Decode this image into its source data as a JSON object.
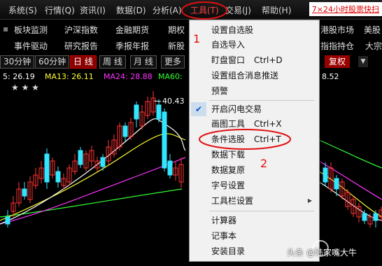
{
  "menubar": {
    "items": [
      {
        "label": "系统(S)",
        "active": false
      },
      {
        "label": "行情(Q)",
        "active": false
      },
      {
        "label": "资讯(I)",
        "active": false
      },
      {
        "label": "数据(D)",
        "active": false
      },
      {
        "label": "分析(A)",
        "active": false
      },
      {
        "label": "工具(T)",
        "active": true
      },
      {
        "label": "交易(J)",
        "active": false
      },
      {
        "label": "帮助(H)",
        "active": false
      }
    ],
    "promo": "7×24小时股票快扫"
  },
  "toolbar": {
    "row2": [
      "板块监测",
      "沪深指数",
      "金融期货",
      "期权",
      "港股市场",
      "美股"
    ],
    "row3": [
      "事件驱动",
      "研究报告",
      "季报年报",
      "新股",
      "指指持仓",
      "大宗"
    ]
  },
  "periods": {
    "tabs": [
      "30分钟",
      "60分钟",
      "日 线",
      "周 线",
      "月 线",
      "更多"
    ],
    "selected": "日 线",
    "fuquan": "复权"
  },
  "ma_line": {
    "ma5": "5: 26.19",
    "ma13": "MA13: 26.11",
    "ma24": "MA24: 28.88",
    "ma60": "MA60:",
    "tail": "8.52"
  },
  "stars": "★  ★  ★",
  "chart": {
    "high_label": "40.43",
    "colors": {
      "up": "#ff3333",
      "down": "#33e6ff",
      "ma5": "#ffffff",
      "ma13": "#ffff33",
      "ma24": "#ff33ff",
      "ma60": "#33ff33"
    }
  },
  "tools_menu": {
    "items": [
      {
        "label": "设置自选股",
        "shortcut": ""
      },
      {
        "label": "自选导入",
        "shortcut": ""
      },
      {
        "label": "盯盘窗口",
        "shortcut": "Ctrl+D"
      },
      {
        "label": "设置组合消息推送",
        "shortcut": ""
      },
      {
        "label": "预警",
        "shortcut": ""
      },
      {
        "label": "开启闪电交易",
        "shortcut": "",
        "checked": true
      },
      {
        "label": "画图工具",
        "shortcut": "Ctrl+X"
      },
      {
        "label": "条件选股",
        "shortcut": "Ctrl+T",
        "highlighted": true
      },
      {
        "label": "数据下载",
        "shortcut": ""
      },
      {
        "label": "数据复原",
        "shortcut": ""
      },
      {
        "label": "字号设置",
        "shortcut": ""
      },
      {
        "label": "工具栏设置",
        "shortcut": "",
        "submenu": true
      },
      {
        "label": "计算器",
        "shortcut": ""
      },
      {
        "label": "记事本",
        "shortcut": ""
      },
      {
        "label": "安装目录",
        "shortcut": ""
      }
    ]
  },
  "annotations": {
    "step1": "1",
    "step2": "2"
  },
  "watermark": "头条 @陆家嘴大牛"
}
